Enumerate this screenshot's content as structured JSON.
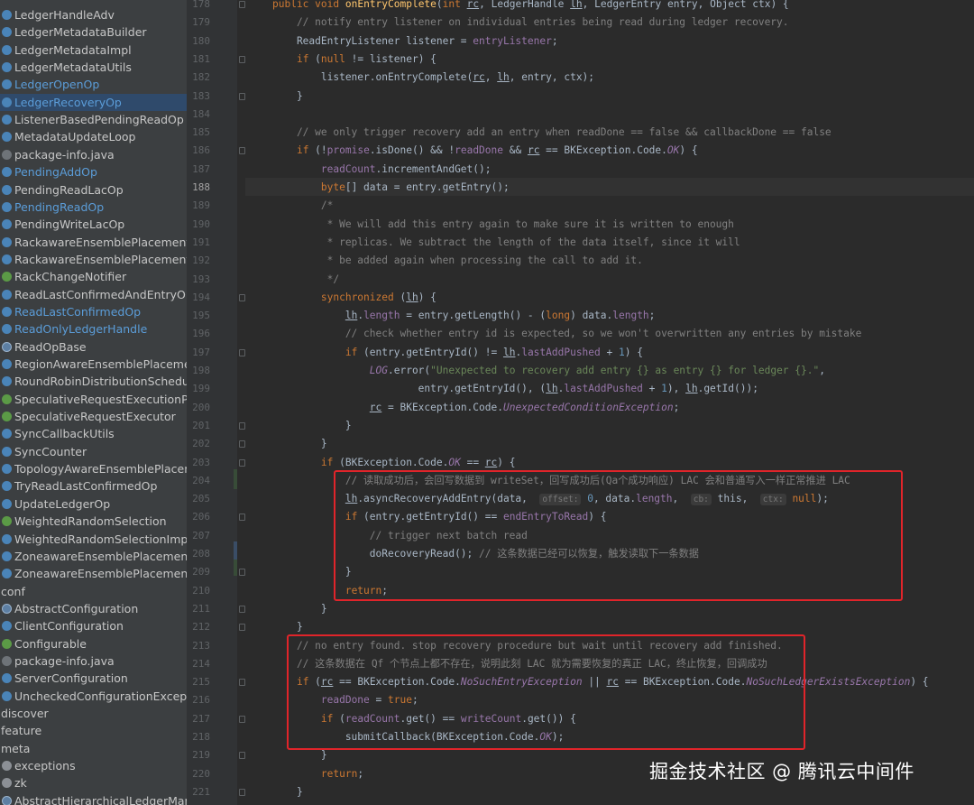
{
  "sidebar": {
    "items": [
      {
        "label": "LedgerHandleAdv",
        "icon": "class-icon",
        "color": "normal"
      },
      {
        "label": "LedgerMetadataBuilder",
        "icon": "class-icon",
        "color": "normal"
      },
      {
        "label": "LedgerMetadataImpl",
        "icon": "class-icon",
        "color": "normal"
      },
      {
        "label": "LedgerMetadataUtils",
        "icon": "class-icon",
        "color": "normal"
      },
      {
        "label": "LedgerOpenOp",
        "icon": "class-icon",
        "color": "blue"
      },
      {
        "label": "LedgerRecoveryOp",
        "icon": "class-icon",
        "color": "blue",
        "selected": true
      },
      {
        "label": "ListenerBasedPendingReadOp",
        "icon": "class-icon",
        "color": "normal"
      },
      {
        "label": "MetadataUpdateLoop",
        "icon": "class-icon",
        "color": "normal"
      },
      {
        "label": "package-info.java",
        "icon": "file-icon",
        "color": "normal"
      },
      {
        "label": "PendingAddOp",
        "icon": "class-icon",
        "color": "blue"
      },
      {
        "label": "PendingReadLacOp",
        "icon": "class-icon",
        "color": "normal"
      },
      {
        "label": "PendingReadOp",
        "icon": "class-icon",
        "color": "blue"
      },
      {
        "label": "PendingWriteLacOp",
        "icon": "class-icon",
        "color": "normal"
      },
      {
        "label": "RackawareEnsemblePlacementP",
        "icon": "class-icon",
        "color": "normal"
      },
      {
        "label": "RackawareEnsemblePlacementP",
        "icon": "class-icon",
        "color": "normal"
      },
      {
        "label": "RackChangeNotifier",
        "icon": "interface-icon",
        "color": "normal"
      },
      {
        "label": "ReadLastConfirmedAndEntryOp",
        "icon": "class-icon",
        "color": "normal"
      },
      {
        "label": "ReadLastConfirmedOp",
        "icon": "class-icon",
        "color": "blue"
      },
      {
        "label": "ReadOnlyLedgerHandle",
        "icon": "class-icon",
        "color": "blue"
      },
      {
        "label": "ReadOpBase",
        "icon": "abstract-class-icon",
        "color": "normal"
      },
      {
        "label": "RegionAwareEnsemblePlacemen",
        "icon": "class-icon",
        "color": "normal"
      },
      {
        "label": "RoundRobinDistributionSchedule",
        "icon": "class-icon",
        "color": "normal"
      },
      {
        "label": "SpeculativeRequestExecutionPol",
        "icon": "interface-icon",
        "color": "normal"
      },
      {
        "label": "SpeculativeRequestExecutor",
        "icon": "interface-icon",
        "color": "normal"
      },
      {
        "label": "SyncCallbackUtils",
        "icon": "class-icon",
        "color": "normal"
      },
      {
        "label": "SyncCounter",
        "icon": "class-icon",
        "color": "normal"
      },
      {
        "label": "TopologyAwareEnsemblePlaceme",
        "icon": "class-icon",
        "color": "normal"
      },
      {
        "label": "TryReadLastConfirmedOp",
        "icon": "class-icon",
        "color": "normal"
      },
      {
        "label": "UpdateLedgerOp",
        "icon": "class-icon",
        "color": "normal"
      },
      {
        "label": "WeightedRandomSelection",
        "icon": "interface-icon",
        "color": "normal"
      },
      {
        "label": "WeightedRandomSelectionImpl",
        "icon": "class-icon",
        "color": "normal"
      },
      {
        "label": "ZoneawareEnsemblePlacementP",
        "icon": "class-icon",
        "color": "normal"
      },
      {
        "label": "ZoneawareEnsemblePlacementP",
        "icon": "class-icon",
        "color": "normal"
      },
      {
        "label": "conf",
        "icon": "",
        "color": "normal",
        "folder": true
      },
      {
        "label": "AbstractConfiguration",
        "icon": "abstract-class-icon",
        "color": "normal"
      },
      {
        "label": "ClientConfiguration",
        "icon": "class-icon",
        "color": "normal"
      },
      {
        "label": "Configurable",
        "icon": "interface-icon",
        "color": "normal"
      },
      {
        "label": "package-info.java",
        "icon": "file-icon",
        "color": "normal"
      },
      {
        "label": "ServerConfiguration",
        "icon": "class-icon",
        "color": "normal"
      },
      {
        "label": "UncheckedConfigurationExcepti",
        "icon": "class-icon",
        "color": "normal"
      },
      {
        "label": "discover",
        "icon": "",
        "color": "normal",
        "folder": true
      },
      {
        "label": "feature",
        "icon": "",
        "color": "normal",
        "folder": true
      },
      {
        "label": "meta",
        "icon": "",
        "color": "normal",
        "folder": true
      },
      {
        "label": "exceptions",
        "icon": "folder-icon",
        "color": "normal",
        "subfolder": true
      },
      {
        "label": "zk",
        "icon": "folder-icon",
        "color": "normal",
        "subfolder": true
      },
      {
        "label": "AbstractHierarchicalLedgerMana",
        "icon": "abstract-class-icon",
        "color": "normal"
      }
    ]
  },
  "editor": {
    "current_line": "188",
    "line_numbers": [
      "178",
      "179",
      "180",
      "181",
      "182",
      "183",
      "184",
      "185",
      "186",
      "187",
      "188",
      "189",
      "190",
      "191",
      "192",
      "193",
      "194",
      "195",
      "196",
      "197",
      "198",
      "199",
      "200",
      "201",
      "202",
      "203",
      "204",
      "205",
      "206",
      "207",
      "208",
      "209",
      "210",
      "211",
      "212",
      "213",
      "214",
      "215",
      "216",
      "217",
      "218",
      "219",
      "220",
      "221"
    ],
    "lines": [
      "public void onEntryComplete(int rc, LedgerHandle lh, LedgerEntry entry, Object ctx) {",
      "    // notify entry listener on individual entries being read during ledger recovery.",
      "    ReadEntryListener listener = entryListener;",
      "    if (null != listener) {",
      "        listener.onEntryComplete(rc, lh, entry, ctx);",
      "    }",
      "",
      "    // we only trigger recovery add an entry when readDone == false && callbackDone == false",
      "    if (!promise.isDone() && !readDone && rc == BKException.Code.OK) {",
      "        readCount.incrementAndGet();",
      "        byte[] data = entry.getEntry();",
      "        /*",
      "         * We will add this entry again to make sure it is written to enough",
      "         * replicas. We subtract the length of the data itself, since it will",
      "         * be added again when processing the call to add it.",
      "         */",
      "        synchronized (lh) {",
      "            lh.length = entry.getLength() - (long) data.length;",
      "            // check whether entry id is expected, so we won't overwritten any entries by mistake",
      "            if (entry.getEntryId() != lh.lastAddPushed + 1) {",
      "                LOG.error(\"Unexpected to recovery add entry {} as entry {} for ledger {}.\",",
      "                        entry.getEntryId(), (lh.lastAddPushed + 1), lh.getId());",
      "                rc = BKException.Code.UnexpectedConditionException;",
      "            }",
      "        }",
      "        if (BKException.Code.OK == rc) {",
      "            // 读取成功后，会回写数据到 writeSet，回写成功后(Qa个成功响应) LAC 会和普通写入一样正常推进 LAC",
      "            lh.asyncRecoveryAddEntry(data,  offset: 0, data.length,  cb: this,  ctx: null);",
      "            if (entry.getEntryId() == endEntryToRead) {",
      "                // trigger next batch read",
      "                doRecoveryRead(); // 这条数据已经可以恢复，触发读取下一条数据",
      "            }",
      "            return;",
      "        }",
      "    }",
      "    // no entry found. stop recovery procedure but wait until recovery add finished.",
      "    // 这条数据在 Qf 个节点上都不存在，说明此刻 LAC 就为需要恢复的真正 LAC，终止恢复，回调成功",
      "    if (rc == BKException.Code.NoSuchEntryException || rc == BKException.Code.NoSuchLedgerExistsException) {",
      "        readDone = true;",
      "        if (readCount.get() == writeCount.get()) {",
      "            submitCallback(BKException.Code.OK);",
      "        }",
      "        return;",
      "    }"
    ]
  },
  "watermark": "掘金技术社区 @ 腾讯云中间件",
  "colors": {
    "accent_red": "#e0242a",
    "keyword": "#cc7832",
    "comment": "#808080",
    "string": "#6a8759",
    "field": "#9876aa",
    "method": "#ffc66d"
  }
}
